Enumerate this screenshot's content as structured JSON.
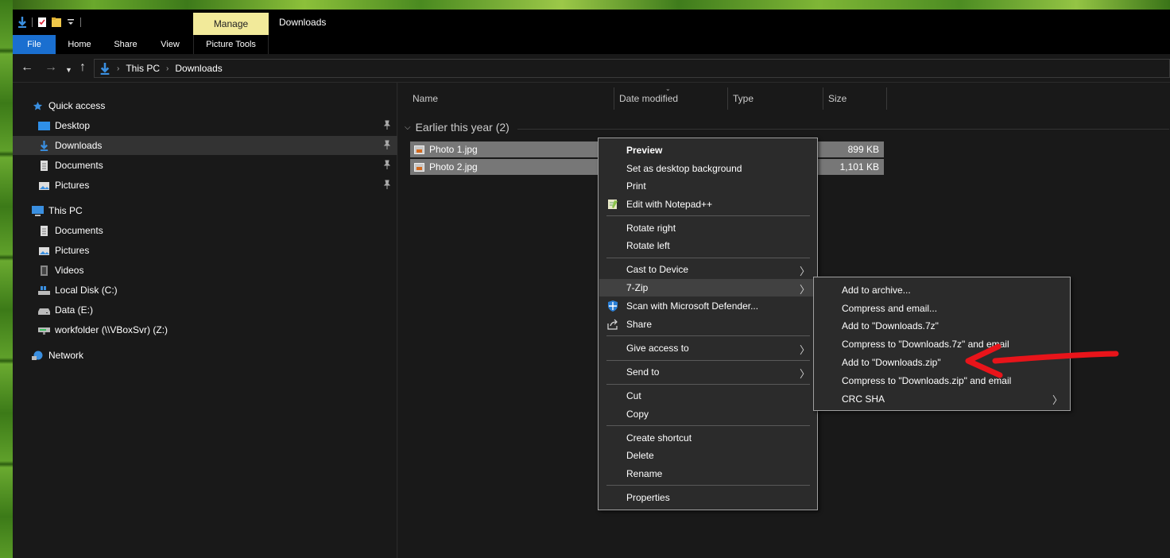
{
  "window": {
    "title": "Downloads",
    "contextual_tab": "Manage"
  },
  "ribbon": {
    "tabs": [
      "File",
      "Home",
      "Share",
      "View",
      "Picture Tools"
    ]
  },
  "address": {
    "crumbs": [
      "This PC",
      "Downloads"
    ]
  },
  "nav": {
    "quick_access": "Quick access",
    "quick_items": [
      "Desktop",
      "Downloads",
      "Documents",
      "Pictures"
    ],
    "this_pc": "This PC",
    "pc_items": [
      "Documents",
      "Pictures",
      "Videos",
      "Local Disk (C:)",
      "Data (E:)",
      "workfolder (\\\\VBoxSvr) (Z:)"
    ],
    "network": "Network"
  },
  "columns": {
    "name": "Name",
    "date_modified": "Date modified",
    "type": "Type",
    "size": "Size"
  },
  "group": {
    "label": "Earlier this year (2)"
  },
  "files": [
    {
      "name": "Photo 1.jpg",
      "size": "899 KB"
    },
    {
      "name": "Photo 2.jpg",
      "size": "1,101 KB"
    }
  ],
  "context_menu": {
    "preview": "Preview",
    "set_background": "Set as desktop background",
    "print": "Print",
    "edit_notepad": "Edit with Notepad++",
    "rotate_right": "Rotate right",
    "rotate_left": "Rotate left",
    "cast": "Cast to Device",
    "seven_zip": "7-Zip",
    "scan": "Scan with Microsoft Defender...",
    "share": "Share",
    "give_access": "Give access to",
    "send_to": "Send to",
    "cut": "Cut",
    "copy": "Copy",
    "create_shortcut": "Create shortcut",
    "delete": "Delete",
    "rename": "Rename",
    "properties": "Properties"
  },
  "submenu_7zip": {
    "items": [
      "Add to archive...",
      "Compress and email...",
      "Add to \"Downloads.7z\"",
      "Compress to \"Downloads.7z\" and email",
      "Add to \"Downloads.zip\"",
      "Compress to \"Downloads.zip\" and email",
      "CRC SHA"
    ]
  },
  "colors": {
    "accent": "#1a6fd0",
    "manage_tab": "#f2ea9a",
    "annotation_arrow": "#e8141a"
  }
}
